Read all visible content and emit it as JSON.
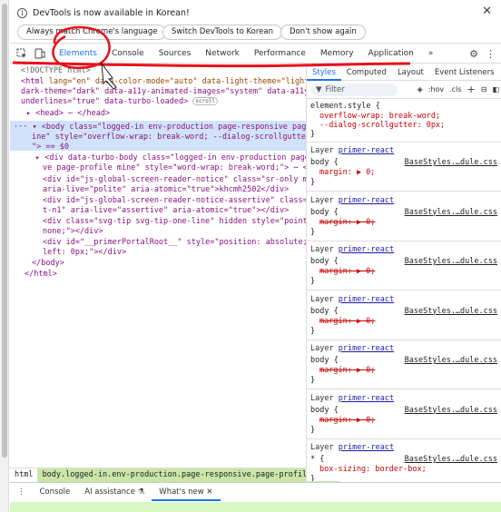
{
  "infobar": {
    "message": "DevTools is now available in Korean!",
    "buttons": [
      "Always match Chrome's language",
      "Switch DevTools to Korean",
      "Don't show again"
    ],
    "close": "✕"
  },
  "tabbar": {
    "tabs": [
      "Elements",
      "Console",
      "Sources",
      "Network",
      "Performance",
      "Memory",
      "Application"
    ],
    "more": "»",
    "selected": "Elements"
  },
  "elements": {
    "doctype": "<!DOCTYPE html>",
    "lines": [
      {
        "indent": 0,
        "html_open": "<html ",
        "attrs": "lang=\"en\" data-color-mode=\"auto\" data-light-theme=\"light\" data-",
        "rest": ""
      },
      {
        "indent": 0,
        "text": "dark-theme=\"dark\" data-a11y-animated-images=\"system\" data-a11y-link-"
      },
      {
        "indent": 0,
        "text": "underlines=\"true\" data-turbo-loaded>",
        "badge": "scroll"
      },
      {
        "indent": 1,
        "text": "▸ <head> ⋯ </head>"
      },
      {
        "indent": 0,
        "text": "··· ▾ <body class=\"logged-in env-production page-responsive page-profile m"
      },
      {
        "indent": 1,
        "text": "ine\" style=\"overflow-wrap: break-word; --dialog-scrollgutter: 0px;"
      },
      {
        "indent": 1,
        "text": "\"> == $0"
      },
      {
        "indent": 2,
        "text": "▸ <div data-turbo-body class=\"logged-in env-production page-responsi"
      },
      {
        "indent": 2,
        "text": "ve page-profile mine\" style=\"word-wrap: break-word;\"> ⋯ </div>"
      },
      {
        "indent": 2,
        "text": "<div id=\"js-global-screen-reader-notice\" class=\"sr-only mt-n1\""
      },
      {
        "indent": 2,
        "text": "aria-live=\"polite\" aria-atomic=\"true\">khcmh2502</div>"
      },
      {
        "indent": 2,
        "text": "<div id=\"js-global-screen-reader-notice-assertive\" class=\"sr-only m"
      },
      {
        "indent": 2,
        "text": "t-n1\" aria-live=\"assertive\" aria-atomic=\"true\"></div>"
      },
      {
        "indent": 2,
        "text": "<div class=\"svg-tip svg-tip-one-line\" hidden style=\"pointer-events:"
      },
      {
        "indent": 2,
        "text": "none;\"></div>"
      },
      {
        "indent": 2,
        "text": "<div id=\"__primerPortalRoot__\" style=\"position: absolute; top: 0px;"
      },
      {
        "indent": 2,
        "text": "left: 0px;\"></div>"
      },
      {
        "indent": 1,
        "text": "</body>"
      },
      {
        "indent": 0,
        "text": "</html>"
      }
    ]
  },
  "breadcrumbs": [
    "html",
    "body.logged-in.env-production.page-responsive.page-profile.mine"
  ],
  "styles": {
    "tabs": [
      "Styles",
      "Computed",
      "Layout",
      "Event Listeners"
    ],
    "selected": "Styles",
    "filter_placeholder": "Filter",
    "tools": [
      ":hov",
      ".cls",
      "+"
    ],
    "element_style": {
      "selector": "element.style {",
      "props": [
        "overflow-wrap: break-word;",
        "--dialog-scrollgutter: 0px;"
      ],
      "close": "}"
    },
    "layers": [
      {
        "layer": "Layer",
        "link": "primer-react",
        "selector": "body {",
        "src": "BaseStyles.…dule.css",
        "prop": "margin: ▶ 0;",
        "struck": false
      },
      {
        "layer": "Layer",
        "link": "primer-react",
        "selector": "body {",
        "src": "BaseStyles.…dule.css",
        "prop": "margin: ▶ 0;",
        "struck": true
      },
      {
        "layer": "Layer",
        "link": "primer-react",
        "selector": "body {",
        "src": "BaseStyles.…dule.css",
        "prop": "margin: ▶ 0;",
        "struck": true
      },
      {
        "layer": "Layer",
        "link": "primer-react",
        "selector": "body {",
        "src": "BaseStyles.…dule.css",
        "prop": "margin: ▶ 0;",
        "struck": true
      },
      {
        "layer": "Layer",
        "link": "primer-react",
        "selector": "body {",
        "src": "BaseStyles.…dule.css",
        "prop": "margin: ▶ 0;",
        "struck": true
      },
      {
        "layer": "Layer",
        "link": "primer-react",
        "selector": "body {",
        "src": "BaseStyles.…dule.css",
        "prop": "margin: ▶ 0;",
        "struck": true
      },
      {
        "layer": "Layer",
        "link": "primer-react",
        "selector": "* {",
        "src": "BaseStyles.…dule.css",
        "prop": "box-sizing: border-box;",
        "struck": false
      }
    ]
  },
  "drawer": {
    "tabs": [
      "Console",
      "AI assistance",
      "What's new"
    ],
    "selected": "What's new"
  },
  "colors": {
    "accent": "#1a73e8",
    "annotation_red": "#e8101a",
    "selected_crumb": "#c9e6a8"
  }
}
